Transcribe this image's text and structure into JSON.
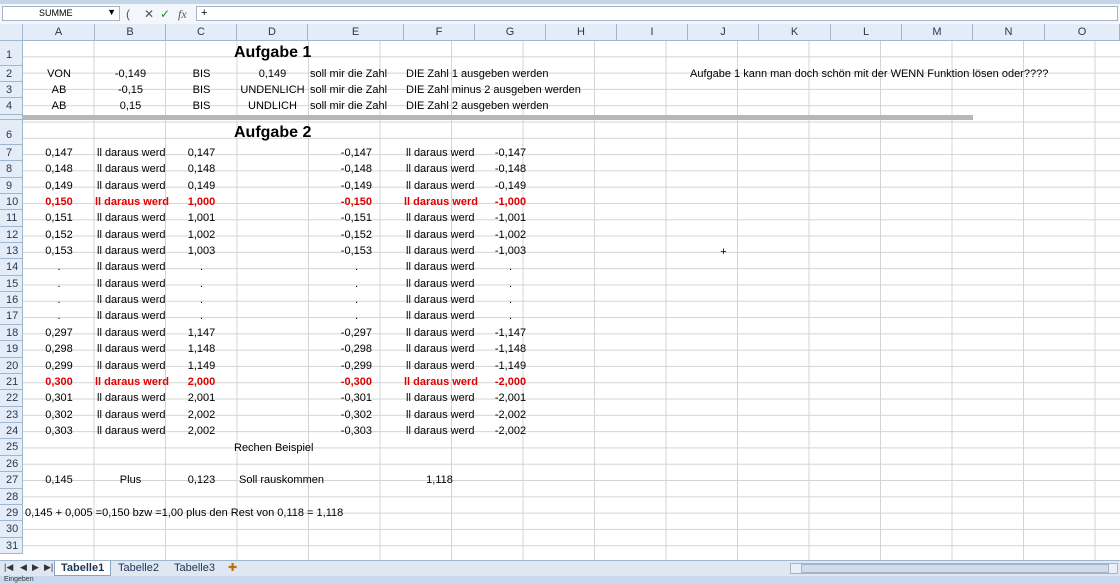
{
  "formula_bar": {
    "name_box": "SUMME",
    "formula": "+"
  },
  "columns": [
    "A",
    "B",
    "C",
    "D",
    "E",
    "F",
    "G",
    "H",
    "I",
    "J",
    "K",
    "L",
    "M",
    "N",
    "O"
  ],
  "rows": [
    "1",
    "2",
    "3",
    "4",
    "6",
    "7",
    "8",
    "9",
    "10",
    "11",
    "12",
    "13",
    "14",
    "15",
    "16",
    "17",
    "18",
    "19",
    "20",
    "21",
    "22",
    "23",
    "24",
    "25",
    "26",
    "27",
    "28",
    "29",
    "30",
    "31"
  ],
  "cells": {
    "r1": {
      "title": "Aufgabe 1"
    },
    "r2": {
      "a": "VON",
      "b": "-0,149",
      "c": "BIS",
      "d": "0,149",
      "e": "soll  mir die Zahl",
      "f": "DIE Zahl 1 ausgeben werden",
      "j": "Aufgabe 1 kann man doch schön mit der WENN Funktion lösen oder????"
    },
    "r3": {
      "a": "AB",
      "b": "-0,15",
      "c": "BIS",
      "d": "UNDENLICH",
      "e": "soll  mir die Zahl",
      "f": "DIE Zahl minus 2 ausgeben werden"
    },
    "r4": {
      "a": "AB",
      "b": "0,15",
      "c": "BIS",
      "d": "UNDLICH",
      "e": "soll  mir die Zahl",
      "f": "DIE Zahl 2 ausgeben werden"
    },
    "r6": {
      "title": "Aufgabe 2"
    },
    "r7": {
      "a": "0,147",
      "b": "ll daraus werd",
      "c": "0,147",
      "e": "-0,147",
      "f": "ll daraus werd",
      "g": "-0,147"
    },
    "r8": {
      "a": "0,148",
      "b": "ll daraus werd",
      "c": "0,148",
      "e": "-0,148",
      "f": "ll daraus werd",
      "g": "-0,148"
    },
    "r9": {
      "a": "0,149",
      "b": "ll daraus werd",
      "c": "0,149",
      "e": "-0,149",
      "f": "ll daraus werd",
      "g": "-0,149"
    },
    "r10": {
      "a": "0,150",
      "b": "ll daraus werd",
      "c": "1,000",
      "e": "-0,150",
      "f": "ll daraus werd",
      "g": "-1,000"
    },
    "r11": {
      "a": "0,151",
      "b": "ll daraus werd",
      "c": "1,001",
      "e": "-0,151",
      "f": "ll daraus werd",
      "g": "-1,001"
    },
    "r12": {
      "a": "0,152",
      "b": "ll daraus werd",
      "c": "1,002",
      "e": "-0,152",
      "f": "ll daraus werd",
      "g": "-1,002"
    },
    "r13": {
      "a": "0,153",
      "b": "ll daraus werd",
      "c": "1,003",
      "e": "-0,153",
      "f": "ll daraus werd",
      "g": "-1,003",
      "j": "+"
    },
    "r14": {
      "a": ".",
      "b": "ll daraus werd",
      "c": ".",
      "e": ".",
      "f": "ll daraus werd",
      "g": "."
    },
    "r15": {
      "a": ".",
      "b": "ll daraus werd",
      "c": ".",
      "e": ".",
      "f": "ll daraus werd",
      "g": "."
    },
    "r16": {
      "a": ".",
      "b": "ll daraus werd",
      "c": ".",
      "e": ".",
      "f": "ll daraus werd",
      "g": "."
    },
    "r17": {
      "a": ".",
      "b": "ll daraus werd",
      "c": ".",
      "e": ".",
      "f": "ll daraus werd",
      "g": "."
    },
    "r18": {
      "a": "0,297",
      "b": "ll daraus werd",
      "c": "1,147",
      "e": "-0,297",
      "f": "ll daraus werd",
      "g": "-1,147"
    },
    "r19": {
      "a": "0,298",
      "b": "ll daraus werd",
      "c": "1,148",
      "e": "-0,298",
      "f": "ll daraus werd",
      "g": "-1,148"
    },
    "r20": {
      "a": "0,299",
      "b": "ll daraus werd",
      "c": "1,149",
      "e": "-0,299",
      "f": "ll daraus werd",
      "g": "-1,149"
    },
    "r21": {
      "a": "0,300",
      "b": "ll daraus werd",
      "c": "2,000",
      "e": "-0,300",
      "f": "ll daraus werd",
      "g": "-2,000"
    },
    "r22": {
      "a": "0,301",
      "b": "ll daraus werd",
      "c": "2,001",
      "e": "-0,301",
      "f": "ll daraus werd",
      "g": "-2,001"
    },
    "r23": {
      "a": "0,302",
      "b": "ll daraus werd",
      "c": "2,002",
      "e": "-0,302",
      "f": "ll daraus werd",
      "g": "-2,002"
    },
    "r24": {
      "a": "0,303",
      "b": "ll daraus werd",
      "c": "2,002",
      "e": "-0,303",
      "f": "ll daraus werd",
      "g": "-2,002"
    },
    "r25": {
      "d": "Rechen Beispiel"
    },
    "r27": {
      "a": "0,145",
      "b": "Plus",
      "c": "0,123",
      "d": "Soll rauskommen",
      "f": "1,118"
    },
    "r29": {
      "a": "0,145 + 0,005 =0,150 bzw =1,00 plus den Rest von 0,118 = 1,118"
    }
  },
  "sheet_tabs": [
    "Tabelle1",
    "Tabelle2",
    "Tabelle3"
  ],
  "status": "Eingeben",
  "colors": {
    "highlight": "#e00000",
    "header_bg": "#e4ecf7"
  }
}
